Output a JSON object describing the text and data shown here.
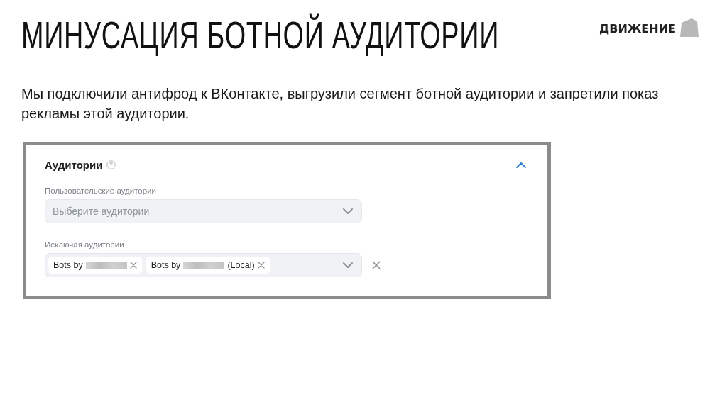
{
  "slide": {
    "title": "МИНУСАЦИЯ БОТНОЙ АУДИТОРИИ",
    "logo": "ДВИЖЕНИЕ",
    "text": "Мы подключили антифрод к ВКонтакте, выгрузили сегмент ботной аудитории и запретили показ рекламы этой аудитории."
  },
  "panel": {
    "title": "Аудитории",
    "expanded": true,
    "fields": [
      {
        "label": "Пользовательские аудитории",
        "placeholder": "Выберите аудитории"
      },
      {
        "label": "Исключая аудитории",
        "tags": [
          {
            "prefix": "Bots by"
          },
          {
            "prefix": "Bots by",
            "suffix": "(Local)"
          }
        ]
      }
    ]
  }
}
